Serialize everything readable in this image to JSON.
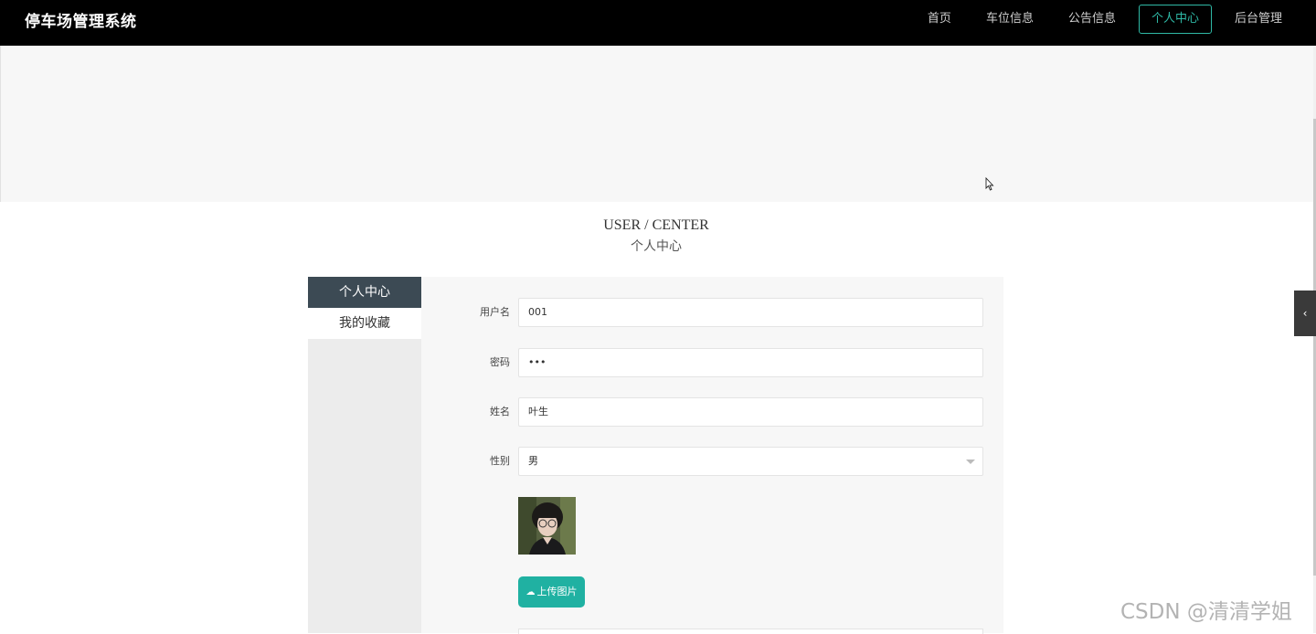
{
  "header": {
    "brand": "停车场管理系统",
    "nav": [
      {
        "label": "首页",
        "active": false
      },
      {
        "label": "车位信息",
        "active": false
      },
      {
        "label": "公告信息",
        "active": false
      },
      {
        "label": "个人中心",
        "active": true
      },
      {
        "label": "后台管理",
        "active": false
      }
    ]
  },
  "section": {
    "title_en": "USER / CENTER",
    "title_cn": "个人中心"
  },
  "sidebar": {
    "items": [
      {
        "label": "个人中心",
        "active": true
      },
      {
        "label": "我的收藏",
        "active": false
      }
    ]
  },
  "form": {
    "username": {
      "label": "用户名",
      "value": "001"
    },
    "password": {
      "label": "密码",
      "value": "•••"
    },
    "name": {
      "label": "姓名",
      "value": "叶生"
    },
    "gender": {
      "label": "性别",
      "value": "男"
    },
    "upload_label": "上传图片"
  },
  "icons": {
    "upload": "cloud-upload-icon",
    "toggle": "chevron-left-icon"
  },
  "colors": {
    "accent": "#20b1a2",
    "topbar": "#000000",
    "sidebar_active": "#3c4a54"
  },
  "watermark": "CSDN @清清学姐"
}
